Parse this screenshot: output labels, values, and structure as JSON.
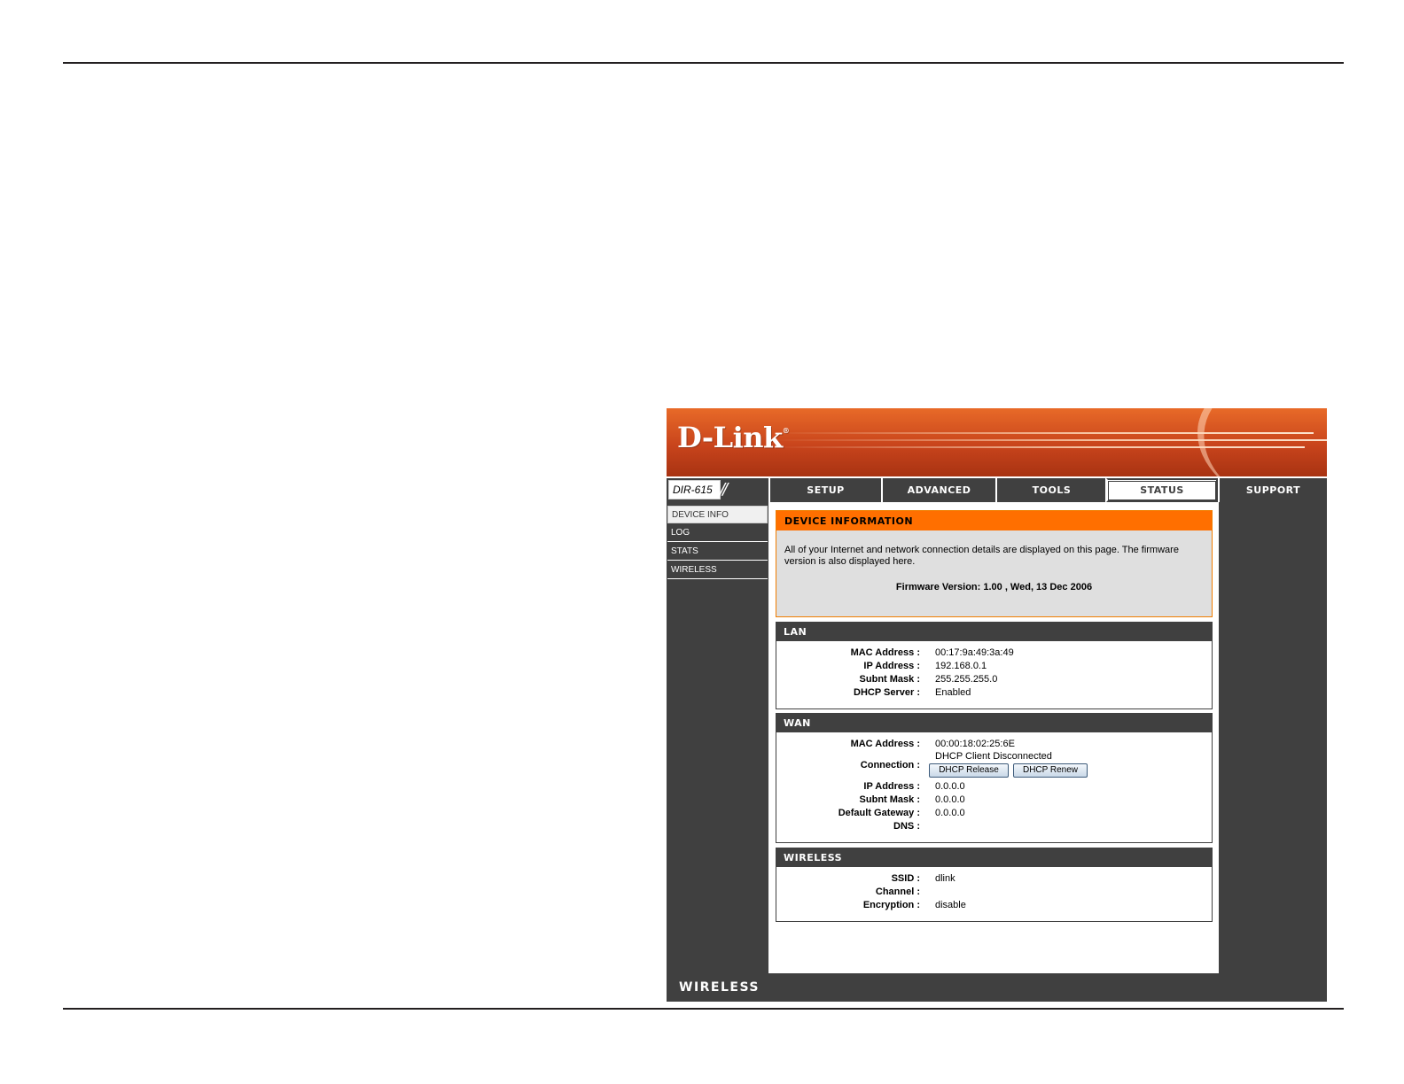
{
  "brand": {
    "logo": "D-Link",
    "model": "DIR-615",
    "footer": "WIRELESS"
  },
  "nav": {
    "tabs": [
      {
        "label": "SETUP"
      },
      {
        "label": "ADVANCED"
      },
      {
        "label": "TOOLS"
      },
      {
        "label": "STATUS",
        "active": true
      },
      {
        "label": "SUPPORT"
      }
    ]
  },
  "sidebar": {
    "items": [
      {
        "label": "DEVICE INFO",
        "active": true
      },
      {
        "label": "LOG"
      },
      {
        "label": "STATS"
      },
      {
        "label": "WIRELESS"
      }
    ]
  },
  "device_info": {
    "title": "DEVICE INFORMATION",
    "description": "All of your Internet and network connection details are displayed on this page. The firmware version is also displayed here.",
    "firmware": "Firmware Version: 1.00 , Wed, 13 Dec 2006"
  },
  "lan": {
    "title": "LAN",
    "rows": [
      {
        "label": "MAC Address :",
        "value": "00:17:9a:49:3a:49"
      },
      {
        "label": "IP Address :",
        "value": "192.168.0.1"
      },
      {
        "label": "Subnt Mask :",
        "value": "255.255.255.0"
      },
      {
        "label": "DHCP Server :",
        "value": "Enabled"
      }
    ]
  },
  "wan": {
    "title": "WAN",
    "mac_label": "MAC Address :",
    "mac_value": "00:00:18:02:25:6E",
    "connection_label": "Connection :",
    "connection_value": "DHCP Client Disconnected",
    "release_button": "DHCP Release",
    "renew_button": "DHCP Renew",
    "rows": [
      {
        "label": "IP Address :",
        "value": "0.0.0.0"
      },
      {
        "label": "Subnt Mask :",
        "value": "0.0.0.0"
      },
      {
        "label": "Default Gateway :",
        "value": "0.0.0.0"
      },
      {
        "label": "DNS :",
        "value": ""
      }
    ]
  },
  "wireless": {
    "title": "WIRELESS",
    "rows": [
      {
        "label": "SSID :",
        "value": "dlink"
      },
      {
        "label": "Channel :",
        "value": ""
      },
      {
        "label": "Encryption :",
        "value": "disable"
      }
    ]
  },
  "colors": {
    "accent": "#ff6f00",
    "dark": "#404040",
    "banner": "#c8441c"
  }
}
